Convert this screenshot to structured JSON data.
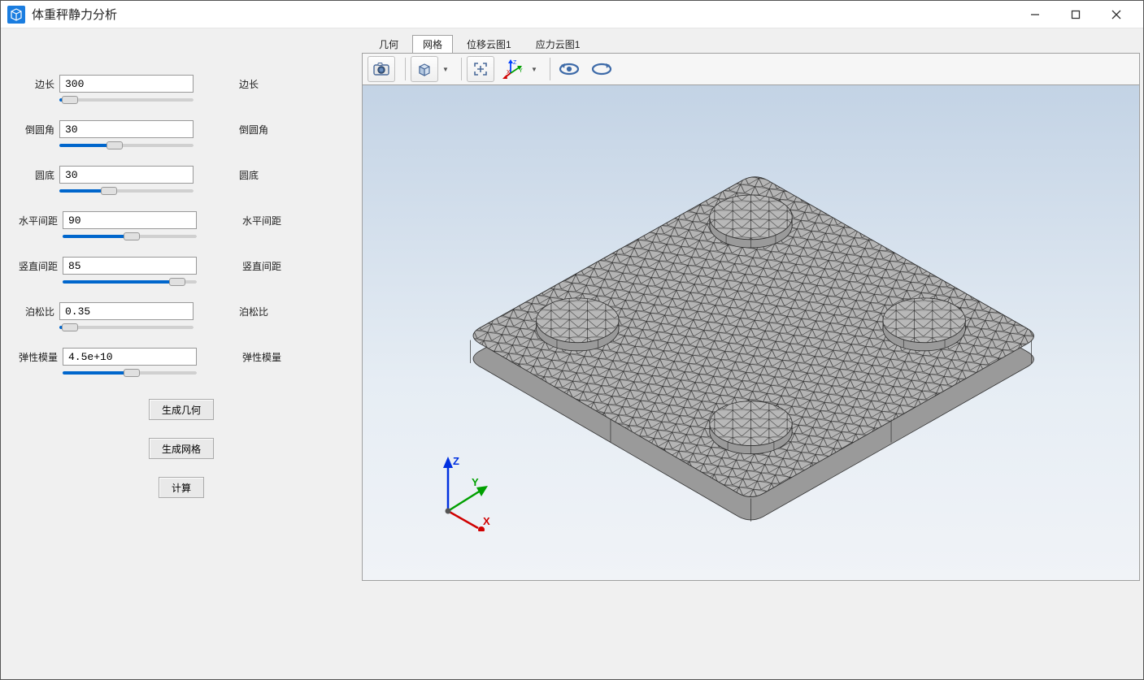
{
  "window": {
    "title": "体重秤静力分析"
  },
  "params": [
    {
      "key": "edge_length",
      "label": "边长",
      "value": "300",
      "side_label": "边长",
      "slider_pct": 2
    },
    {
      "key": "fillet",
      "label": "倒圆角",
      "value": "30",
      "side_label": "倒圆角",
      "slider_pct": 40
    },
    {
      "key": "base_circle",
      "label": "圆底",
      "value": "30",
      "side_label": "圆底",
      "slider_pct": 35
    },
    {
      "key": "h_spacing",
      "label": "水平间距",
      "value": "90",
      "side_label": "水平间距",
      "slider_pct": 52
    },
    {
      "key": "v_spacing",
      "label": "竖直间距",
      "value": "85",
      "side_label": "竖直间距",
      "slider_pct": 90
    },
    {
      "key": "poisson",
      "label": "泊松比",
      "value": "0.35",
      "side_label": "泊松比",
      "slider_pct": 2
    },
    {
      "key": "elastic",
      "label": "弹性模量",
      "value": "4.5e+10",
      "side_label": "弹性模量",
      "slider_pct": 52
    }
  ],
  "buttons": {
    "generate_geometry": "生成几何",
    "generate_mesh": "生成网格",
    "compute": "计算"
  },
  "tabs": [
    {
      "id": "geometry",
      "label": "几何",
      "active": false
    },
    {
      "id": "mesh",
      "label": "网格",
      "active": true
    },
    {
      "id": "disp_contour1",
      "label": "位移云图1",
      "active": false
    },
    {
      "id": "stress_contour1",
      "label": "应力云图1",
      "active": false
    }
  ],
  "toolbar_icons": {
    "camera": "camera-icon",
    "view_cube": "view-cube-icon",
    "fit_view": "fit-view-icon",
    "axes": "axes-icon",
    "rotate_ccw": "rotate-ccw-icon",
    "rotate_cw": "rotate-cw-icon"
  },
  "axis_labels": {
    "x": "X",
    "y": "Y",
    "z": "Z"
  }
}
